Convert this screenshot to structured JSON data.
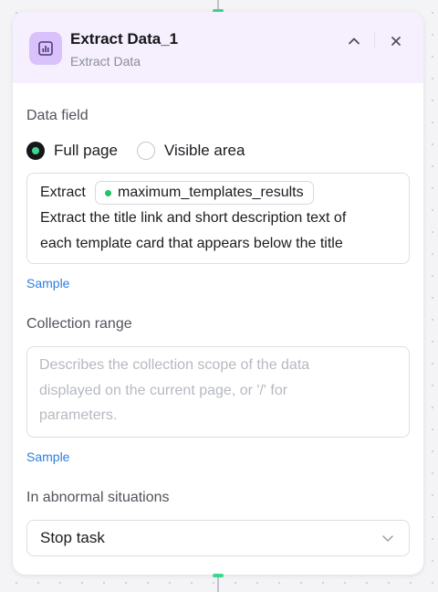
{
  "node": {
    "title": "Extract Data_1",
    "subtitle": "Extract Data",
    "icon": "chart-bar-icon",
    "accent": "#d9c2fb",
    "header_bg": "#f6f0fe"
  },
  "data_field": {
    "label": "Data field",
    "options": [
      {
        "label": "Full page",
        "selected": true
      },
      {
        "label": "Visible area",
        "selected": false
      }
    ],
    "prefix": "Extract",
    "variable_chip": "maximum_templates_results",
    "instruction_lines": [
      "Extract the title link and short description text  of",
      "each template card that appears below the title"
    ],
    "sample_link": "Sample"
  },
  "collection_range": {
    "label": "Collection range",
    "placeholder_lines": [
      "Describes the collection scope of the data",
      "displayed on the current page, or '/' for",
      "parameters."
    ],
    "sample_link": "Sample"
  },
  "abnormal": {
    "label": "In abnormal situations",
    "selected_value": "Stop task"
  },
  "colors": {
    "link": "#2f7fe0",
    "radio_dot": "#3dd68c",
    "connector_dot": "#3dd68c"
  }
}
